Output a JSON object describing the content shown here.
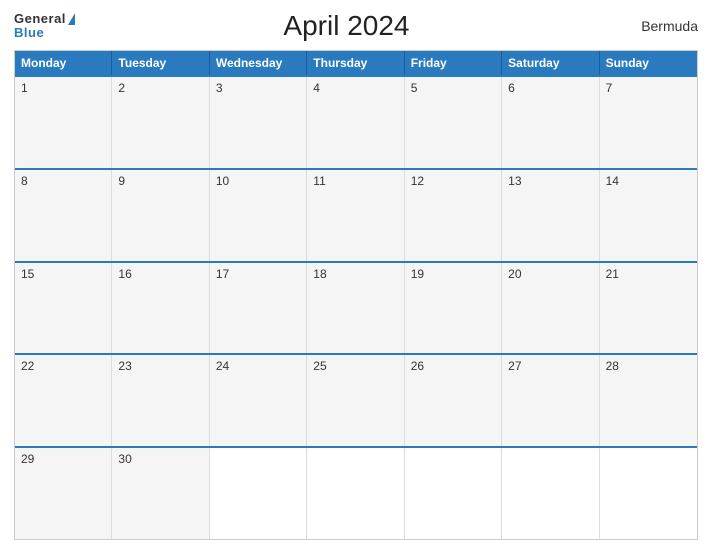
{
  "header": {
    "logo_general": "General",
    "logo_blue": "Blue",
    "title": "April 2024",
    "region": "Bermuda"
  },
  "calendar": {
    "day_headers": [
      "Monday",
      "Tuesday",
      "Wednesday",
      "Thursday",
      "Friday",
      "Saturday",
      "Sunday"
    ],
    "weeks": [
      [
        {
          "day": "1",
          "empty": false
        },
        {
          "day": "2",
          "empty": false
        },
        {
          "day": "3",
          "empty": false
        },
        {
          "day": "4",
          "empty": false
        },
        {
          "day": "5",
          "empty": false
        },
        {
          "day": "6",
          "empty": false
        },
        {
          "day": "7",
          "empty": false
        }
      ],
      [
        {
          "day": "8",
          "empty": false
        },
        {
          "day": "9",
          "empty": false
        },
        {
          "day": "10",
          "empty": false
        },
        {
          "day": "11",
          "empty": false
        },
        {
          "day": "12",
          "empty": false
        },
        {
          "day": "13",
          "empty": false
        },
        {
          "day": "14",
          "empty": false
        }
      ],
      [
        {
          "day": "15",
          "empty": false
        },
        {
          "day": "16",
          "empty": false
        },
        {
          "day": "17",
          "empty": false
        },
        {
          "day": "18",
          "empty": false
        },
        {
          "day": "19",
          "empty": false
        },
        {
          "day": "20",
          "empty": false
        },
        {
          "day": "21",
          "empty": false
        }
      ],
      [
        {
          "day": "22",
          "empty": false
        },
        {
          "day": "23",
          "empty": false
        },
        {
          "day": "24",
          "empty": false
        },
        {
          "day": "25",
          "empty": false
        },
        {
          "day": "26",
          "empty": false
        },
        {
          "day": "27",
          "empty": false
        },
        {
          "day": "28",
          "empty": false
        }
      ],
      [
        {
          "day": "29",
          "empty": false
        },
        {
          "day": "30",
          "empty": false
        },
        {
          "day": "",
          "empty": true
        },
        {
          "day": "",
          "empty": true
        },
        {
          "day": "",
          "empty": true
        },
        {
          "day": "",
          "empty": true
        },
        {
          "day": "",
          "empty": true
        }
      ]
    ]
  }
}
